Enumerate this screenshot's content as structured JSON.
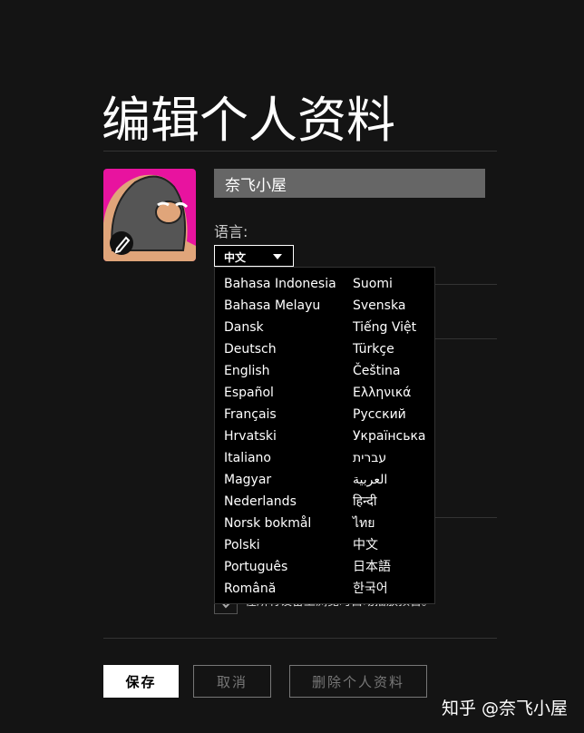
{
  "header": {
    "title": "编辑个人资料"
  },
  "profile": {
    "name": "奈飞小屋",
    "avatar_icon": "cartoon-avatar",
    "edit_icon": "pencil-icon"
  },
  "language": {
    "label": "语言:",
    "selected": "中文",
    "options_col1": [
      "Bahasa Indonesia",
      "Bahasa Melayu",
      "Dansk",
      "Deutsch",
      "English",
      "Español",
      "Français",
      "Hrvatski",
      "Italiano",
      "Magyar",
      "Nederlands",
      "Norsk bokmål",
      "Polski",
      "Português",
      "Română"
    ],
    "options_col2": [
      "Suomi",
      "Svenska",
      "Tiếng Việt",
      "Türkçe",
      "Čeština",
      "Ελληνικά",
      "Русский",
      "Українська",
      "עברית",
      "العربية",
      "हिन्दी",
      "ไทย",
      "中文",
      "日本語",
      "한국어"
    ]
  },
  "autoplay": {
    "preview_label": "在所有设备上浏览时自动播放预告。"
  },
  "buttons": {
    "save": "保存",
    "cancel": "取消",
    "delete": "删除个人资料"
  },
  "watermark": "知乎 @奈飞小屋"
}
